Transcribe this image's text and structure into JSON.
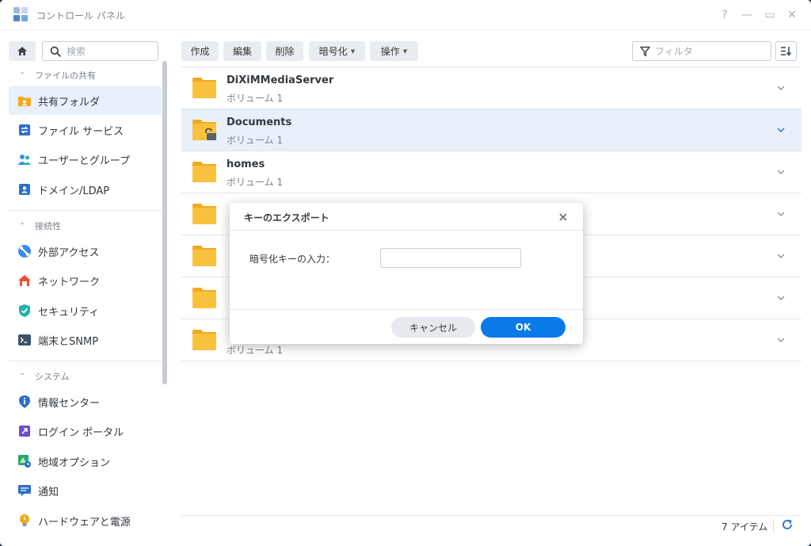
{
  "window": {
    "title": "コントロール パネル",
    "controls": {
      "help": "?",
      "minimize": "—",
      "maximize": "▭",
      "close": "✕"
    }
  },
  "sidebar": {
    "search_placeholder": "検索",
    "sections": [
      {
        "label": "ファイルの共有",
        "items": [
          {
            "label": "共有フォルダ",
            "icon": "shared-folder-icon",
            "active": true
          },
          {
            "label": "ファイル サービス",
            "icon": "file-services-icon"
          },
          {
            "label": "ユーザーとグループ",
            "icon": "users-groups-icon"
          },
          {
            "label": "ドメイン/LDAP",
            "icon": "domain-ldap-icon"
          }
        ]
      },
      {
        "label": "接続性",
        "items": [
          {
            "label": "外部アクセス",
            "icon": "external-access-icon"
          },
          {
            "label": "ネットワーク",
            "icon": "network-icon"
          },
          {
            "label": "セキュリティ",
            "icon": "security-shield-icon"
          },
          {
            "label": "端末とSNMP",
            "icon": "terminal-icon"
          }
        ]
      },
      {
        "label": "システム",
        "items": [
          {
            "label": "情報センター",
            "icon": "info-center-icon"
          },
          {
            "label": "ログイン ポータル",
            "icon": "login-portal-icon"
          },
          {
            "label": "地域オプション",
            "icon": "regional-options-icon"
          },
          {
            "label": "通知",
            "icon": "notification-icon"
          },
          {
            "label": "ハードウェアと電源",
            "icon": "hardware-power-icon"
          }
        ]
      }
    ]
  },
  "toolbar": {
    "create": "作成",
    "edit": "編集",
    "delete": "削除",
    "encryption": "暗号化",
    "action": "操作",
    "filter_placeholder": "フィルタ"
  },
  "folders": [
    {
      "name": "DiXiMMediaServer",
      "volume": "ボリューム 1"
    },
    {
      "name": "Documents",
      "volume": "ボリューム 1",
      "selected": true,
      "locked": true
    },
    {
      "name": "homes",
      "volume": "ボリューム 1"
    },
    {
      "name": "",
      "volume": ""
    },
    {
      "name": "",
      "volume": ""
    },
    {
      "name": "",
      "volume": ""
    },
    {
      "name": "",
      "volume": "ボリューム 1"
    }
  ],
  "status": {
    "count": "7 アイテム"
  },
  "dialog": {
    "title": "キーのエクスポート",
    "label": "暗号化キーの入力：",
    "input_value": "",
    "cancel": "キャンセル",
    "ok": "OK"
  },
  "colors": {
    "accent": "#0a7ae8",
    "selected_row": "#e8f0fa",
    "folder": "#f9c23c",
    "folder_tab": "#f3a81f"
  }
}
